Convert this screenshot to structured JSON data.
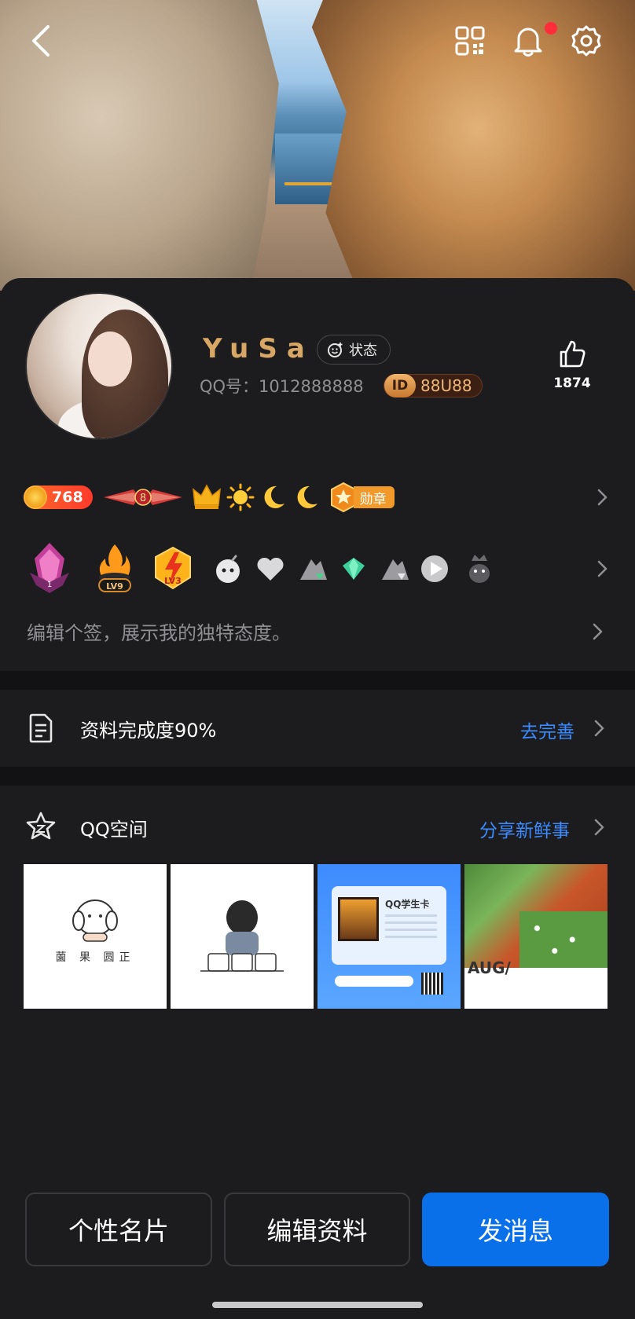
{
  "header": {
    "back_icon": "back-arrow-icon",
    "qr_icon": "qr-code-icon",
    "bell_icon": "bell-icon",
    "gear_icon": "gear-icon",
    "notification_dot_color": "#ff2d3a"
  },
  "profile": {
    "nickname": "YuSa",
    "status_label": "状态",
    "qq_label": "QQ号：1012888888",
    "lianghao_badge": "ID",
    "lianghao_number": "88U88",
    "likes": "1874"
  },
  "badges": {
    "coins": "768",
    "wings_level": "8",
    "medal_label": "勋章",
    "level_badge_1": "LV9",
    "level_badge_2": "LV3"
  },
  "signature": {
    "placeholder": "编辑个签，展示我的独特态度。"
  },
  "completion": {
    "label": "资料完成度90%",
    "link": "去完善"
  },
  "qzone": {
    "title": "QQ空间",
    "link": "分享新鲜事",
    "photos": [
      {
        "caption": "薗 果 圆正"
      },
      {
        "caption": ""
      },
      {
        "caption": "QQ学生卡"
      },
      {
        "caption": "AUG/"
      }
    ]
  },
  "actions": {
    "card": "个性名片",
    "edit": "编辑资料",
    "message": "发消息"
  },
  "colors": {
    "accent_blue": "#0a70ea",
    "link_blue": "#3b8bff",
    "nickname_gold": "#d9a765",
    "background": "#1c1c1e"
  }
}
